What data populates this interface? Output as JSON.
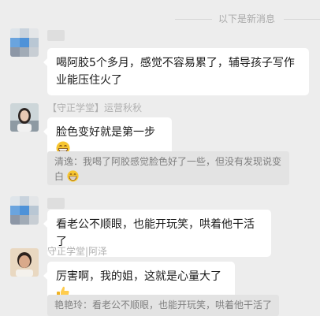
{
  "divider": {
    "text": "以下是新消息"
  },
  "messages": [
    {
      "sender": "",
      "text": "喝阿胶5个多月，感觉不容易累了，辅导孩子写作业能压住火了"
    },
    {
      "sender": "【守正学堂】运营秋秋",
      "text": "脸色变好就是第一步"
    },
    {
      "quote": "清逸：我喝了阿胶感觉脸色好了一些，但没有发现说变白"
    },
    {
      "sender": "",
      "text": "看老公不顺眼，也能开玩笑，哄着他干活了"
    },
    {
      "sender": "守正学堂|阿泽",
      "text": "厉害啊，我的姐，这就是心量大了"
    },
    {
      "quote": "艳艳玲：看老公不顺眼，也能开玩笑，哄着他干活了"
    }
  ],
  "icons": {
    "grin": "grinning-face-emoji",
    "thumbs": "thumbs-up-emoji"
  }
}
